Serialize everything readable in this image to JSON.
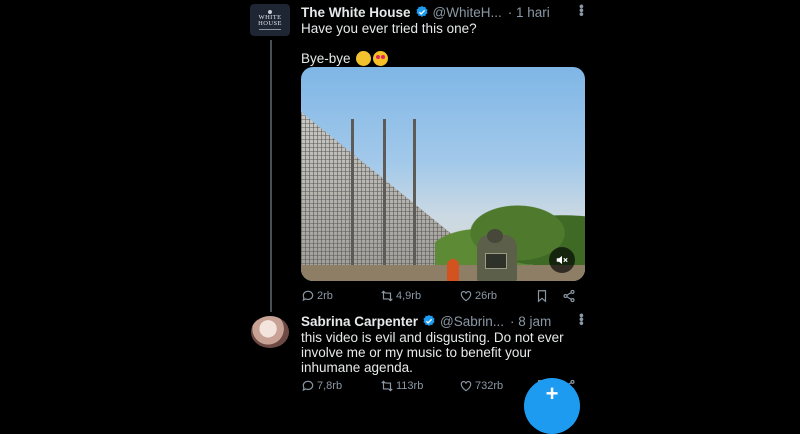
{
  "tweets": [
    {
      "author": "The White House",
      "handle": "@WhiteH...",
      "time": "· 1 hari",
      "avatar_lines": [
        "WHITE",
        "HOUSE"
      ],
      "text_line1": "Have you ever tried this one?",
      "text_line2": "Bye-bye",
      "emojis": [
        "waving-hand",
        "heart-eyes"
      ],
      "media": "video",
      "stats": {
        "replies": "2rb",
        "retweets": "4,9rb",
        "likes": "26rb"
      }
    },
    {
      "author": "Sabrina Carpenter",
      "handle": "@Sabrin...",
      "time": "· 8 jam",
      "text": "this video is evil and disgusting. Do not ever involve me or my music to benefit your inhumane agenda.",
      "stats": {
        "replies": "7,8rb",
        "retweets": "113rb",
        "likes": "732rb"
      }
    }
  ],
  "colors": {
    "background": "#000000",
    "text": "#e7e9ea",
    "muted": "#8b98a5",
    "accent": "#1d9bf0",
    "thread": "#4a4f54"
  },
  "icons": [
    "verified-icon",
    "more-icon",
    "reply-icon",
    "retweet-icon",
    "like-icon",
    "bookmark-icon",
    "share-icon",
    "mute-icon",
    "compose-icon"
  ]
}
